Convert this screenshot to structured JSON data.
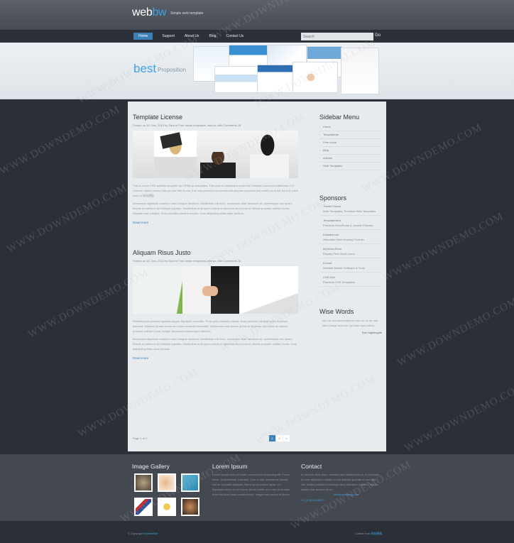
{
  "header": {
    "logo_a": "web",
    "logo_b": "bw",
    "tagline": "Simple web template"
  },
  "nav": {
    "items": [
      "Home",
      "Support",
      "About Us",
      "Blog",
      "Contact Us"
    ],
    "search_placeholder": "Search",
    "go_label": "Go"
  },
  "banner": {
    "best": "best",
    "proposition": "Proposition"
  },
  "posts": [
    {
      "title": "Template License",
      "meta": "Posted on 16. Dec, 2013 by Sara in Free online templates, interior, with Comments 28",
      "paragraphs": [
        "This is a free CSS website template by CSSMojo templates. This work is distributed under the Creative Commons Attribution 3.0 License, which means that you are free to use it for any personal or commercial purpose provided you credit me in the form of a link back to 网站模板.",
        "Maecenas dignissim mauris in arcu congue tincidunt. Vestibulum elit nunc, accumsan vitae faucibus vel, scelerisque nec quam. Mauris at metus in mi tristique egestas. Vestibulum ante ipsum primis in faucibus orci luctus et ultrices posuere cubilia Curae; Aliquam erat volutpat. Sed convallis posuere mauris. Cras adipiscing tellus vitae pretium."
      ],
      "read_more": "Read more"
    },
    {
      "title": "Aliquam Risus Justo",
      "meta": "Posted on 16. Dec, 2013 by Sara in Free online templates, interior, with Comments 28",
      "paragraphs": [
        "Pellentesque posuere egestas augue dignissim convallis. Proin quis molestie mauris. Nunc pulvinar volutpat lorem tincidunt placerat. Aliquam ornare lectus nec tortor molestie imperdiet. Vestibulum ante ipsum primis in faucibus orci luctus et ultrices posuere cubilia Curae; Integer accumsan ullamcorper ultricies.",
        "Maecenas dignissim mauris in arcu congue tincidunt. Vestibulum elit nunc, accumsan vitae faucibus vel, scelerisque nec quam. Mauris at metus in mi tristique egestas. Vestibulum ante ipsum primis in faucibus orci luctus et ultrices posuere cubilia Curae; Cras adipiscing tellus vitae pretium."
      ],
      "read_more": "Read more"
    }
  ],
  "pagination": {
    "label": "Page 1 of 2",
    "pages": [
      "1",
      "2",
      "»"
    ]
  },
  "sidebar": {
    "menu_title": "Sidebar Menu",
    "menu_items": [
      "Home",
      "Templatehile",
      "Free Icons",
      "Blog",
      "Articles",
      "Web Templates"
    ],
    "sponsors_title": "Sponsors",
    "sponsors": [
      {
        "name": "Theme Forest",
        "desc": "Web Templates, Premium Web Templates"
      },
      {
        "name": "TemplateNerd",
        "desc": "Premium WordPress & Joomla Themes"
      },
      {
        "name": "Undated.net",
        "desc": "Affordable Web Hosting Provider"
      },
      {
        "name": "MyVectorStore",
        "desc": "Royalty Free Stock Icons"
      },
      {
        "name": "Evrsoft",
        "desc": "Website Builder Software & Tools"
      },
      {
        "name": "CSS Hub",
        "desc": "Premium CSS Templates"
      }
    ],
    "wise_title": "Wise Words",
    "quote": "We can let circumstances rule us, or we can take charge and rule our lives from within.",
    "quote_author": "Earl Nightingale"
  },
  "footer": {
    "gallery_title": "Image Gallery",
    "lorem_title": "Lorem Ipsum",
    "lorem_text": "Lorem ipsum dolor sit amet, consectetur adipiscing elit. Fusce tellus. Suspendisse interdum. Duis et nisl. Maecenas blandit, nisl ac convallis aliquam, libero lorem ornare lacus, vel dignissim tortor mi vel purus. Morbi mattis arcu nisl, ut semper dolor tincidunt justo consectetuer. Integer non neque et libero.",
    "contact_title": "Contact",
    "contact_text": "In vel sem vitae diam, sodales non ullamcorper id, et convallis, in nunc aliquam a sapien et nisl aliquam gravida eu porttitor nisi. Mollis phasellus interdum diam interdum sodales, mauris lacinia erat semper tortor.",
    "contact_email": "info@company.com",
    "contact_phone": "+1 (123) 444-5677"
  },
  "bottom": {
    "copyright_prefix": "© Copyright ",
    "copyright_link": "MyWebSite",
    "collect_prefix": "Collect from ",
    "collect_link": "网站模板"
  },
  "watermark": "WWW.DOWNDEMO.COM"
}
